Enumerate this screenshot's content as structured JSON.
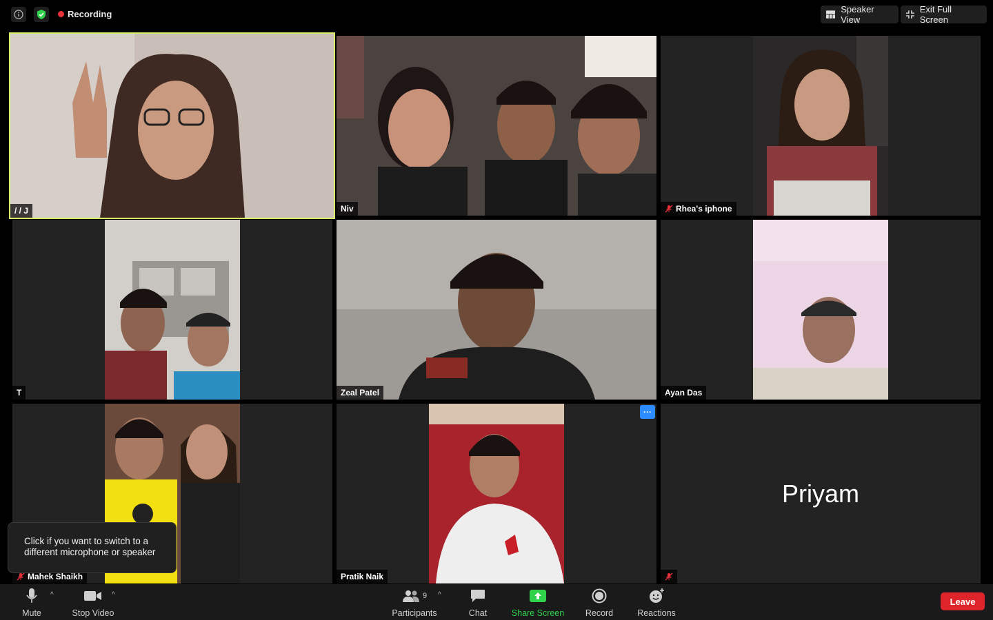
{
  "top_bar": {
    "recording_label": "Recording",
    "speaker_view_label": "Speaker View",
    "exit_full_screen_label": "Exit Full Screen"
  },
  "participants": [
    {
      "name": "/ / J",
      "muted": false,
      "active_speaker": true
    },
    {
      "name": "Niv",
      "muted": false
    },
    {
      "name": "Rhea's iphone",
      "muted": true
    },
    {
      "name": "T",
      "muted": false
    },
    {
      "name": "Zeal Patel",
      "muted": false
    },
    {
      "name": "Ayan Das",
      "muted": false
    },
    {
      "name": "Mahek Shaikh",
      "muted": true
    },
    {
      "name": "Pratik Naik",
      "muted": false
    },
    {
      "name": "Priyam",
      "muted": true,
      "video_off": true
    }
  ],
  "tooltip": {
    "text": "Click if you want to switch to a different microphone or speaker"
  },
  "toolbar": {
    "mute_label": "Mute",
    "stop_video_label": "Stop Video",
    "participants_label": "Participants",
    "participants_count": "9",
    "chat_label": "Chat",
    "share_screen_label": "Share Screen",
    "record_label": "Record",
    "reactions_label": "Reactions",
    "leave_label": "Leave"
  },
  "colors": {
    "active_speaker_border": "#d8f06a",
    "recording_dot": "#e8303a",
    "share_screen": "#2fd24a",
    "leave": "#e0242b",
    "more_button": "#2d8cff"
  }
}
